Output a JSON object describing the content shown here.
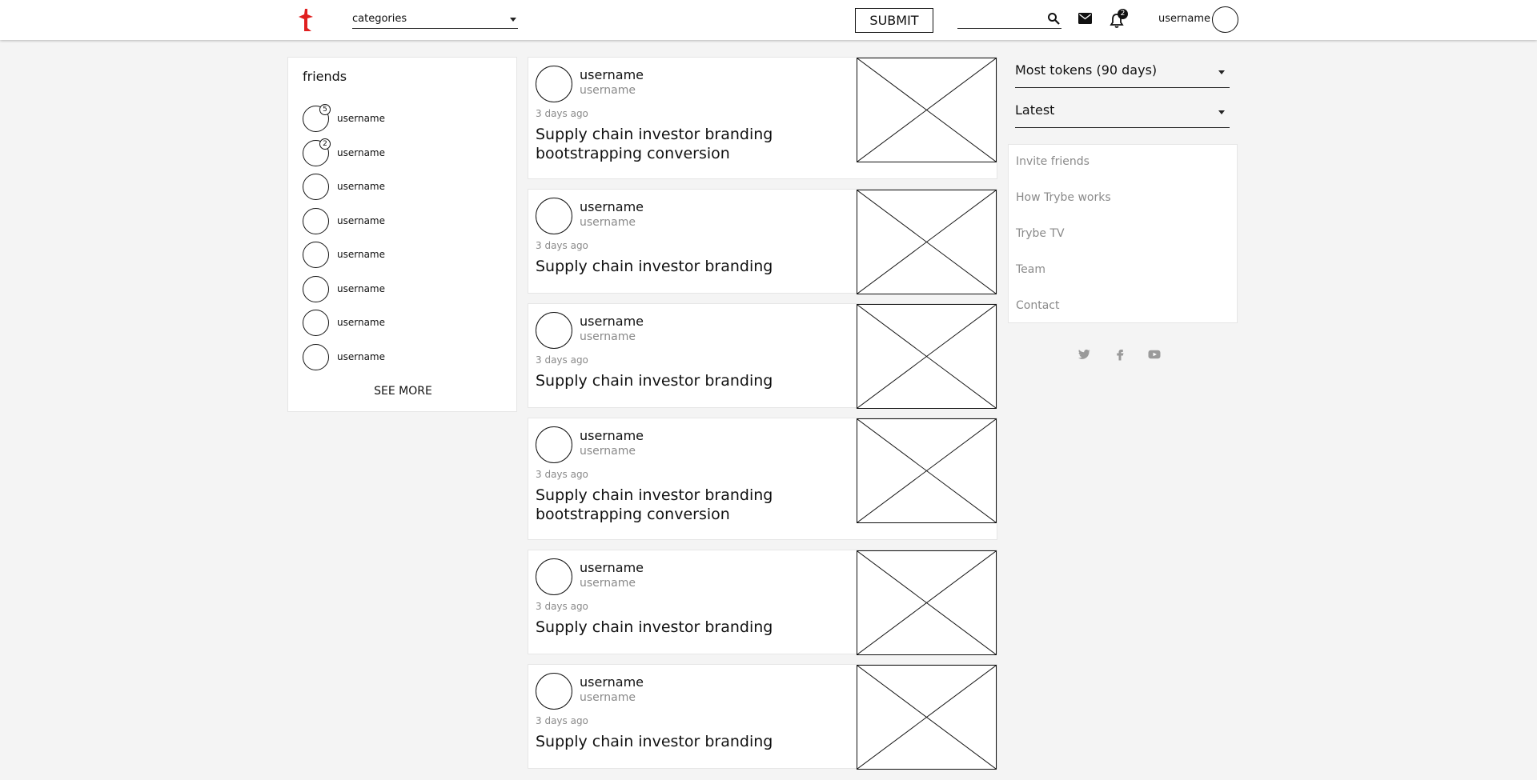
{
  "colors": {
    "brand": "#e02020",
    "muted": "#8a8a8a"
  },
  "header": {
    "logo": "trybe-logo",
    "categories": "categories",
    "submit": "SUBMIT",
    "search_value": "",
    "notifications_count": "2",
    "username": "username"
  },
  "friends": {
    "title": "friends",
    "items": [
      {
        "name": "username",
        "badge": "5"
      },
      {
        "name": "username",
        "badge": "2"
      },
      {
        "name": "username",
        "badge": ""
      },
      {
        "name": "username",
        "badge": ""
      },
      {
        "name": "username",
        "badge": ""
      },
      {
        "name": "username",
        "badge": ""
      },
      {
        "name": "username",
        "badge": ""
      },
      {
        "name": "username",
        "badge": ""
      }
    ],
    "see_more": "SEE MORE"
  },
  "feed": [
    {
      "name": "username",
      "handle": "username",
      "time": "3 days ago",
      "title": "Supply chain investor branding bootstrapping conversion"
    },
    {
      "name": "username",
      "handle": "username",
      "time": "3 days ago",
      "title": "Supply chain investor branding"
    },
    {
      "name": "username",
      "handle": "username",
      "time": "3 days ago",
      "title": "Supply chain investor branding"
    },
    {
      "name": "username",
      "handle": "username",
      "time": "3 days ago",
      "title": "Supply chain investor branding bootstrapping conversion"
    },
    {
      "name": "username",
      "handle": "username",
      "time": "3 days ago",
      "title": "Supply chain investor branding"
    },
    {
      "name": "username",
      "handle": "username",
      "time": "3 days ago",
      "title": "Supply chain investor branding"
    }
  ],
  "sidebar": {
    "sort_primary": "Most tokens (90 days)",
    "sort_secondary": "Latest",
    "links": [
      "Invite friends",
      "How Trybe works",
      "Trybe TV",
      "Team",
      "Contact"
    ],
    "social": [
      "twitter-icon",
      "facebook-icon",
      "youtube-icon"
    ]
  }
}
